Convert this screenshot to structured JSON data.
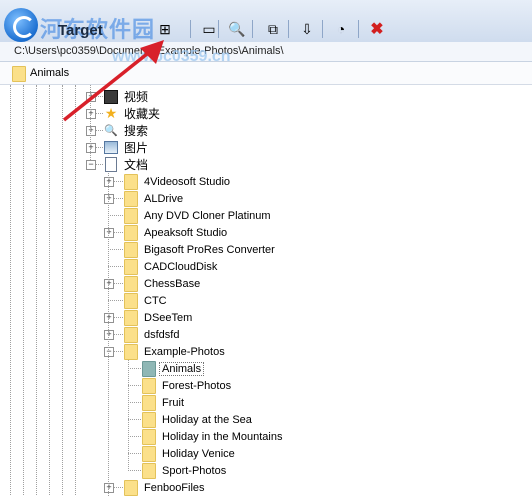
{
  "toolbar": {
    "title": "Target",
    "watermark": "河东软件园",
    "buttons": [
      {
        "name": "add-folder-icon",
        "glyph": "⊞"
      },
      {
        "name": "rename-icon",
        "glyph": "▭"
      },
      {
        "name": "search-icon",
        "glyph": "🔍"
      },
      {
        "name": "copy-icon",
        "glyph": "⧉"
      },
      {
        "name": "move-icon",
        "glyph": "⇩"
      },
      {
        "name": "refresh-icon",
        "glyph": "◔"
      },
      {
        "name": "delete-icon",
        "glyph": "✖"
      }
    ]
  },
  "address": {
    "path": "C:\\Users\\pc0359\\Documents\\Example-Photos\\Animals\\"
  },
  "watermark_url": "www.pc0359.cn",
  "breadcrumb": {
    "label": "Animals"
  },
  "tree": {
    "special": [
      {
        "label": "视频",
        "icon": "video-icon"
      },
      {
        "label": "收藏夹",
        "icon": "star-icon"
      },
      {
        "label": "搜索",
        "icon": "search-icon"
      },
      {
        "label": "图片",
        "icon": "pictures-icon"
      },
      {
        "label": "文档",
        "icon": "documents-icon"
      }
    ],
    "documents_children": [
      {
        "label": "4Videosoft Studio",
        "expandable": true
      },
      {
        "label": "ALDrive",
        "expandable": true
      },
      {
        "label": "Any DVD Cloner Platinum",
        "expandable": false
      },
      {
        "label": "Apeaksoft Studio",
        "expandable": true
      },
      {
        "label": "Bigasoft ProRes Converter",
        "expandable": false
      },
      {
        "label": "CADCloudDisk",
        "expandable": false
      },
      {
        "label": "ChessBase",
        "expandable": true
      },
      {
        "label": "CTC",
        "expandable": false
      },
      {
        "label": "DSeeTem",
        "expandable": true
      },
      {
        "label": "dsfdsfd",
        "expandable": true
      },
      {
        "label": "Example-Photos",
        "expandable": true,
        "expanded": true
      },
      {
        "label": "FenbooFiles",
        "expandable": true
      }
    ],
    "example_photos_children": [
      {
        "label": "Animals",
        "selected": true
      },
      {
        "label": "Forest-Photos"
      },
      {
        "label": "Fruit"
      },
      {
        "label": "Holiday at the Sea"
      },
      {
        "label": "Holiday in the Mountains"
      },
      {
        "label": "Holiday Venice"
      },
      {
        "label": "Sport-Photos"
      }
    ]
  },
  "colors": {
    "folder": "#fbe08a",
    "selected_folder": "#8fb7b5",
    "arrow": "#d8202a"
  }
}
